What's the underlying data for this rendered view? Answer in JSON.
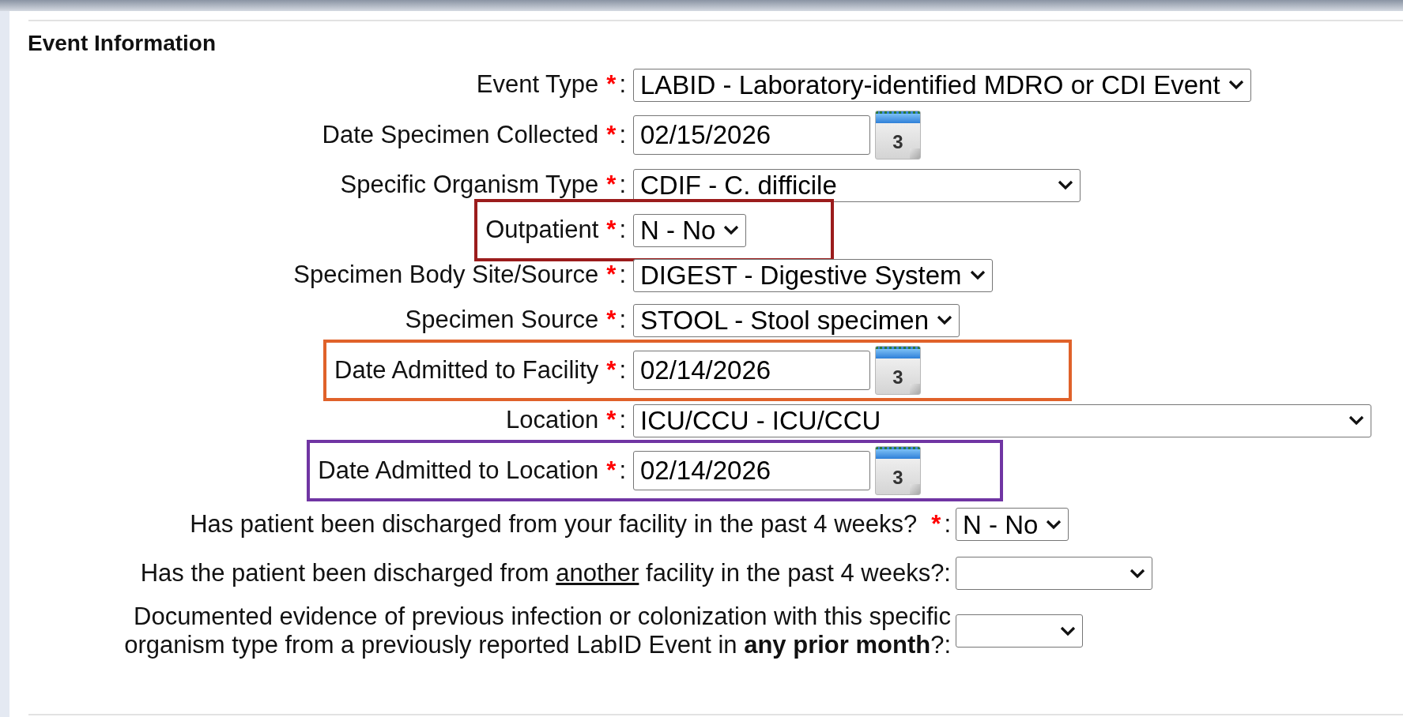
{
  "section": {
    "title": "Event Information"
  },
  "fields": [
    {
      "kind": "select",
      "label": "Event Type",
      "required_mark": "*",
      "colon": ":",
      "value": "LABID - Laboratory-identified MDRO or CDI Event"
    },
    {
      "kind": "date",
      "label": "Date Specimen Collected",
      "required_mark": "*",
      "colon": ":",
      "value": "02/15/2026",
      "calendar_day": "3"
    },
    {
      "kind": "select",
      "label": "Specific Organism Type",
      "required_mark": "*",
      "colon": ":",
      "value": "CDIF - C. difficile"
    },
    {
      "kind": "select",
      "label": "Outpatient",
      "required_mark": "*",
      "colon": ":",
      "value": "N - No",
      "color": "#9b1c1c"
    },
    {
      "kind": "select",
      "label": "Specimen Body Site/Source",
      "required_mark": "*",
      "colon": ":",
      "value": "DIGEST - Digestive System"
    },
    {
      "kind": "select",
      "label": "Specimen Source",
      "required_mark": "*",
      "colon": ":",
      "value": "STOOL - Stool specimen"
    },
    {
      "kind": "date",
      "label": "Date Admitted to Facility",
      "required_mark": "*",
      "colon": ":",
      "value": "02/14/2026",
      "calendar_day": "3",
      "color": "#e0622a"
    },
    {
      "kind": "select",
      "label": "Location",
      "required_mark": "*",
      "colon": ":",
      "value": "ICU/CCU - ICU/CCU"
    },
    {
      "kind": "date",
      "label": "Date Admitted to Location",
      "required_mark": "*",
      "colon": ":",
      "value": "02/14/2026",
      "calendar_day": "3",
      "color": "#7035a3"
    }
  ],
  "questions": [
    {
      "label": "Has patient been discharged from your facility in the past 4 weeks?",
      "required_mark": "*",
      "colon": ":",
      "value": "N - No"
    },
    {
      "label_before": "Has the patient been discharged from",
      "label_underlined": "another",
      "label_after": "facility in the past 4 weeks?:"
    },
    {
      "label": "Documented evidence of previous infection or colonization with this specific organism type from a previously reported LabID Event in **any prior month**?:"
    }
  ]
}
